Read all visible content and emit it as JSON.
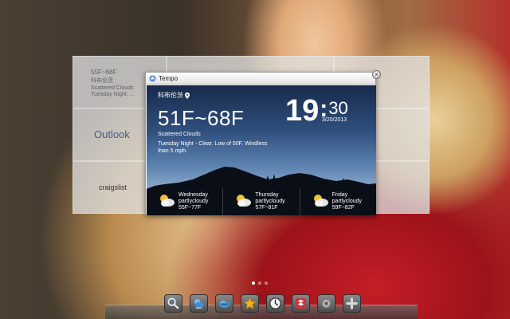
{
  "background_tiles": {
    "tile1_lines": [
      "55F~68F",
      "科布伦茨",
      "Scattered Clouds",
      "Tuesday Night: ..."
    ],
    "outlook_label": "Outlook",
    "craigslist_label": "craigslist"
  },
  "window": {
    "title": "Tempo",
    "close_label": "×",
    "location": "科布伦茨",
    "temp_range": "51F~68F",
    "condition": "Scattered Clouds",
    "forecast_text": "Tuesday Night - Clear. Low of 50F. Windless than 5 mph.",
    "clock": {
      "hour": "19",
      "colon": ":",
      "minute": "30",
      "date": "3/20/2013"
    },
    "days": [
      {
        "name": "Wednesday",
        "condition": "partlycloudy",
        "range": "55F~77F"
      },
      {
        "name": "Thursday",
        "condition": "partlycloudy",
        "range": "57F~81F"
      },
      {
        "name": "Friday",
        "condition": "partlycloudy",
        "range": "59F~82F"
      }
    ]
  },
  "pager": {
    "count": 3,
    "active_index": 0
  },
  "dock": {
    "items": [
      "search-icon",
      "weather-icon",
      "cloud-icon",
      "star-icon",
      "clock-icon",
      "dropbox-icon",
      "gear-icon",
      "plus-icon"
    ]
  },
  "colors": {
    "accent": "#ffffff",
    "sky_top": "#172a4a",
    "sky_mid": "#5c82b0"
  }
}
